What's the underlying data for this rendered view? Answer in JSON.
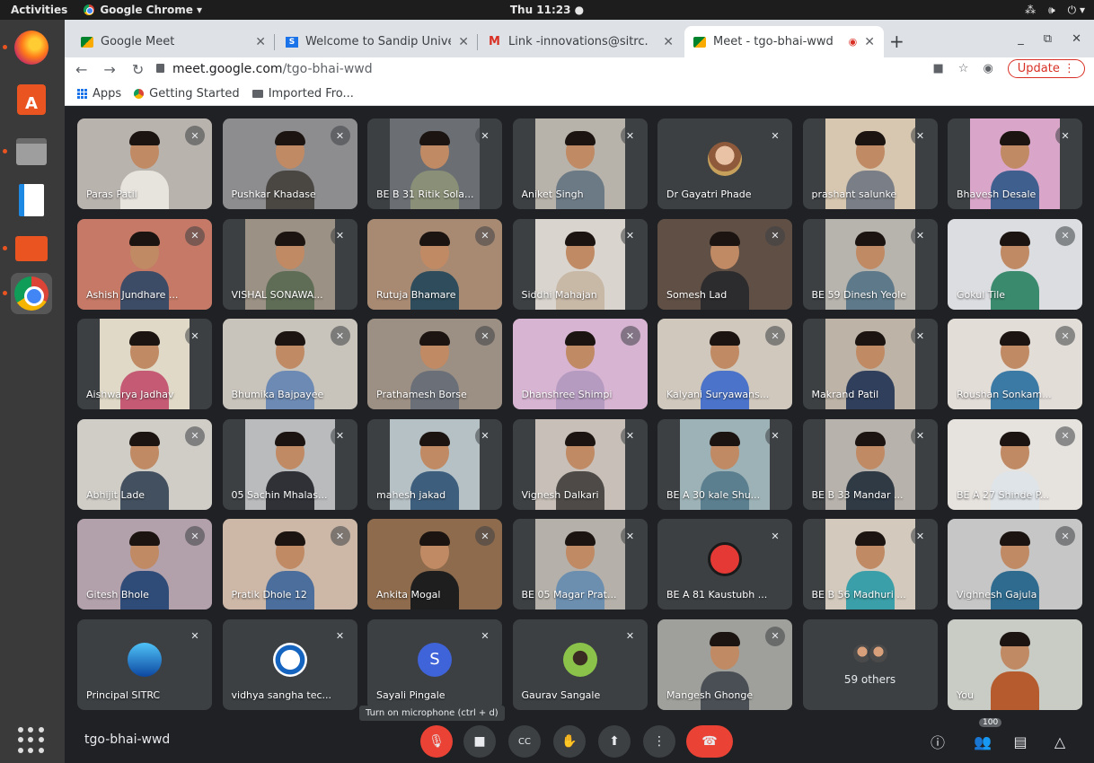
{
  "topbar": {
    "activities": "Activities",
    "app": "Google Chrome ▾",
    "clock": "Thu 11:23 ●",
    "tray": [
      "network-icon",
      "volume-icon",
      "power-icon"
    ]
  },
  "dock": [
    "firefox-icon",
    "software-store-icon",
    "files-icon",
    "writer-icon",
    "folder-icon",
    "chrome-icon"
  ],
  "tabs": [
    {
      "label": "Google Meet",
      "favicon": "meet",
      "active": false
    },
    {
      "label": "Welcome to Sandip Unive",
      "favicon": "s",
      "active": false
    },
    {
      "label": "Link -innovations@sitrc.",
      "favicon": "m",
      "active": false
    },
    {
      "label": "Meet - tgo-bhai-wwd",
      "favicon": "meet",
      "active": true
    }
  ],
  "omnibox": {
    "domain": "meet.google.com",
    "path": "/tgo-bhai-wwd",
    "update": "Update  ⋮"
  },
  "bookmarks": {
    "apps": "Apps",
    "getting_started": "Getting Started",
    "imported": "Imported Fro..."
  },
  "tiles": [
    {
      "name": "Paras Patil",
      "bg": "#b9b3ae",
      "shirt": "#e7e3dd",
      "video": true
    },
    {
      "name": "Pushkar Khadase",
      "bg": "#8d8c8f",
      "shirt": "#4a4743",
      "video": true
    },
    {
      "name": "BE B 31 Ritik Sola...",
      "bg": "#6b6f74",
      "shirt": "#8a9077",
      "video": true,
      "narrow": true
    },
    {
      "name": "Aniket Singh",
      "bg": "#b8b3aa",
      "shirt": "#6c7a86",
      "video": true,
      "narrow": true
    },
    {
      "name": "Dr Gayatri Phade",
      "avatar": "photo"
    },
    {
      "name": "prashant salunke",
      "bg": "#d7c7b0",
      "shirt": "#7a7f87",
      "video": true,
      "narrow": true
    },
    {
      "name": "Bhavesh Desale",
      "bg": "#d9a6c9",
      "shirt": "#3f5f8f",
      "video": true,
      "narrow": true
    },
    {
      "name": "Ashish Jundhare ...",
      "bg": "#c57966",
      "shirt": "#3d4c66",
      "video": true
    },
    {
      "name": "VISHAL SONAWA...",
      "bg": "#9b9184",
      "shirt": "#5f6d57",
      "video": true,
      "narrow": true
    },
    {
      "name": "Rutuja Bhamare",
      "bg": "#a88a73",
      "shirt": "#2e4c5b",
      "video": true
    },
    {
      "name": "Siddhi Mahajan",
      "bg": "#d9d4cd",
      "shirt": "#c8b8a6",
      "video": true,
      "narrow": true
    },
    {
      "name": "Somesh Lad",
      "bg": "#5f4f45",
      "shirt": "#2c2b2e",
      "video": true
    },
    {
      "name": "BE 59 Dinesh Yeole",
      "bg": "#b7b3ad",
      "shirt": "#5e7a8a",
      "video": true,
      "narrow": true
    },
    {
      "name": "Gokul Tile",
      "bg": "#dcdde0",
      "shirt": "#3a8a6e",
      "video": true
    },
    {
      "name": "Aishwarya Jadhav",
      "bg": "#e0d9c7",
      "shirt": "#c45a74",
      "video": true,
      "narrow": true
    },
    {
      "name": "Bhumika Bajpayee",
      "bg": "#c8c3bb",
      "shirt": "#6c8ab3",
      "video": true
    },
    {
      "name": "Prathamesh Borse",
      "bg": "#9c8f83",
      "shirt": "#6a6f78",
      "video": true
    },
    {
      "name": "Dhanshree Shimpi",
      "bg": "#d8b4d3",
      "shirt": "#b69bc1",
      "video": true
    },
    {
      "name": "Kalyani Suryawans...",
      "bg": "#d0c8bd",
      "shirt": "#4a73c9",
      "video": true
    },
    {
      "name": "Makrand Patil",
      "bg": "#bdb3a7",
      "shirt": "#2f3f5c",
      "video": true,
      "narrow": true
    },
    {
      "name": "Roushan Sonkam...",
      "bg": "#e3ddd8",
      "shirt": "#3c7aa6",
      "video": true
    },
    {
      "name": "Abhijit Lade",
      "bg": "#d0cdc7",
      "shirt": "#43505f",
      "video": true
    },
    {
      "name": "05 Sachin Mhalas...",
      "bg": "#b9bbbd",
      "shirt": "#2f3137",
      "video": true,
      "narrow": true
    },
    {
      "name": "mahesh jakad",
      "bg": "#b6c1c6",
      "shirt": "#3d5e7c",
      "video": true,
      "narrow": true
    },
    {
      "name": "Vignesh Dalkari",
      "bg": "#c8c0b8",
      "shirt": "#4d4a47",
      "video": true,
      "narrow": true
    },
    {
      "name": "BE A 30 kale Shu...",
      "bg": "#9db2b6",
      "shirt": "#5b7f8f",
      "video": true,
      "narrow": true
    },
    {
      "name": "BE B 33 Mandar ...",
      "bg": "#b7b2ab",
      "shirt": "#2f3a45",
      "video": true,
      "narrow": true
    },
    {
      "name": "BE A 27 Shinde P...",
      "bg": "#e6e2de",
      "shirt": "#dfe4e8",
      "video": true
    },
    {
      "name": "Gitesh Bhole",
      "bg": "#b2a0aa",
      "shirt": "#2f4c79",
      "video": true
    },
    {
      "name": "Pratik Dhole 12",
      "bg": "#cdb7a6",
      "shirt": "#4b6e9c",
      "video": true
    },
    {
      "name": "Ankita Mogal",
      "bg": "#8e6b4d",
      "shirt": "#1e1e1e",
      "video": true
    },
    {
      "name": "BE 05 Magar Prat...",
      "bg": "#b5b1aa",
      "shirt": "#6c8fb0",
      "video": true,
      "narrow": true
    },
    {
      "name": "BE A 81 Kaustubh ...",
      "avatar": "red"
    },
    {
      "name": "BE B 56 Madhuri ...",
      "bg": "#d3cabd",
      "shirt": "#3a9fa8",
      "video": true,
      "narrow": true
    },
    {
      "name": "Vighnesh Gajula",
      "bg": "#c6c6c6",
      "shirt": "#2f6b8f",
      "video": true
    },
    {
      "name": "Principal SITRC",
      "avatar": "blue"
    },
    {
      "name": "vidhya sangha tec...",
      "avatar": "logo"
    },
    {
      "name": "Sayali Pingale",
      "avatar": "s",
      "initial": "S"
    },
    {
      "name": "Gaurav Sangale",
      "avatar": "glasses"
    },
    {
      "name": "Mangesh Ghonge",
      "bg": "#9fa09b",
      "shirt": "#4a4f55",
      "video": true
    },
    {
      "name": "",
      "others": "59 others"
    },
    {
      "name": "You",
      "bg": "#c9cbc5",
      "shirt": "#b55b2e",
      "video": true
    }
  ],
  "tooltip": "Turn on microphone (ctrl + d)",
  "controls": {
    "meeting_code": "tgo-bhai-wwd",
    "participants_badge": "100",
    "cc": "CC"
  }
}
